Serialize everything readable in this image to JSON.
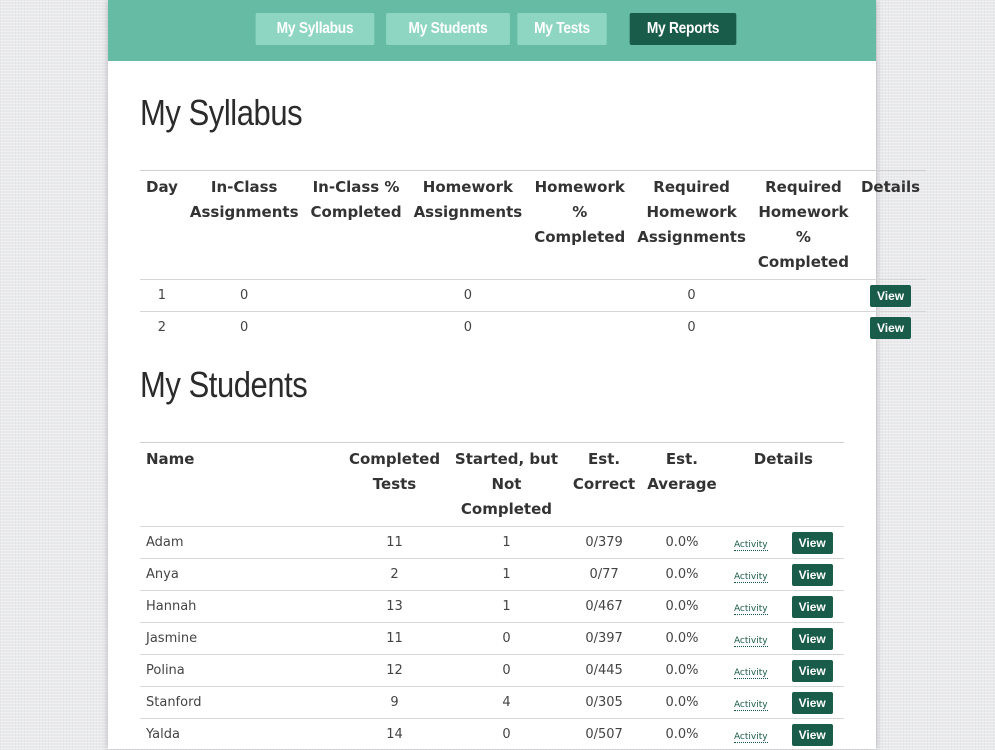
{
  "nav": {
    "items": [
      {
        "label": "My Syllabus",
        "active": false
      },
      {
        "label": "My Students",
        "active": false
      },
      {
        "label": "My Tests",
        "active": false
      },
      {
        "label": "My Reports",
        "active": true
      }
    ]
  },
  "syllabus": {
    "title": "My Syllabus",
    "headers": [
      "Day",
      "In-Class Assignments",
      "In-Class % Completed",
      "Homework Assignments",
      "Homework % Completed",
      "Required Homework Assignments",
      "Required Homework % Completed",
      "Details"
    ],
    "rows": [
      {
        "day": "1",
        "inclass": "0",
        "inclass_pct": "",
        "homework": "0",
        "homework_pct": "",
        "req_homework": "0",
        "req_homework_pct": "",
        "view_label": "View"
      },
      {
        "day": "2",
        "inclass": "0",
        "inclass_pct": "",
        "homework": "0",
        "homework_pct": "",
        "req_homework": "0",
        "req_homework_pct": "",
        "view_label": "View"
      }
    ]
  },
  "students": {
    "title": "My Students",
    "headers": [
      "Name",
      "Completed Tests",
      "Started, but Not Completed",
      "Est. Correct",
      "Est. Average",
      "Details"
    ],
    "activity_label": "Activity",
    "view_label": "View",
    "rows": [
      {
        "name": "Adam",
        "completed": "11",
        "started": "1",
        "correct": "0/379",
        "average": "0.0%"
      },
      {
        "name": "Anya",
        "completed": "2",
        "started": "1",
        "correct": "0/77",
        "average": "0.0%"
      },
      {
        "name": "Hannah",
        "completed": "13",
        "started": "1",
        "correct": "0/467",
        "average": "0.0%"
      },
      {
        "name": "Jasmine",
        "completed": "11",
        "started": "0",
        "correct": "0/397",
        "average": "0.0%"
      },
      {
        "name": "Polina",
        "completed": "12",
        "started": "0",
        "correct": "0/445",
        "average": "0.0%"
      },
      {
        "name": "Stanford",
        "completed": "9",
        "started": "4",
        "correct": "0/305",
        "average": "0.0%"
      },
      {
        "name": "Yalda",
        "completed": "14",
        "started": "0",
        "correct": "0/507",
        "average": "0.0%"
      }
    ]
  },
  "colors": {
    "navbar": "#66bba4",
    "nav_button": "#8ed6c1",
    "nav_button_active": "#1a5c4a",
    "view_button": "#1a5c4a"
  }
}
